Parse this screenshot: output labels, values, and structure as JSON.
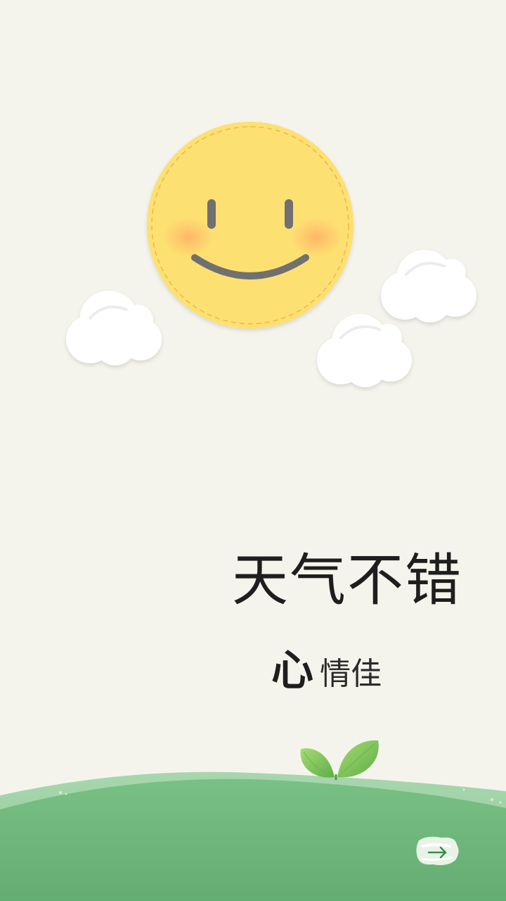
{
  "screen": {
    "headline": "天气不错",
    "subline_emphasis": "心",
    "subline_rest": "情佳"
  },
  "icons": {
    "sun": "smiling-sun-icon",
    "clouds": "cloud-icon",
    "sprout": "sprout-icon",
    "next": "arrow-right-icon"
  },
  "colors": {
    "background": "#f5f4ec",
    "sun": "#fde072",
    "hill": "#6db679",
    "leaf": "#7cc55a"
  }
}
